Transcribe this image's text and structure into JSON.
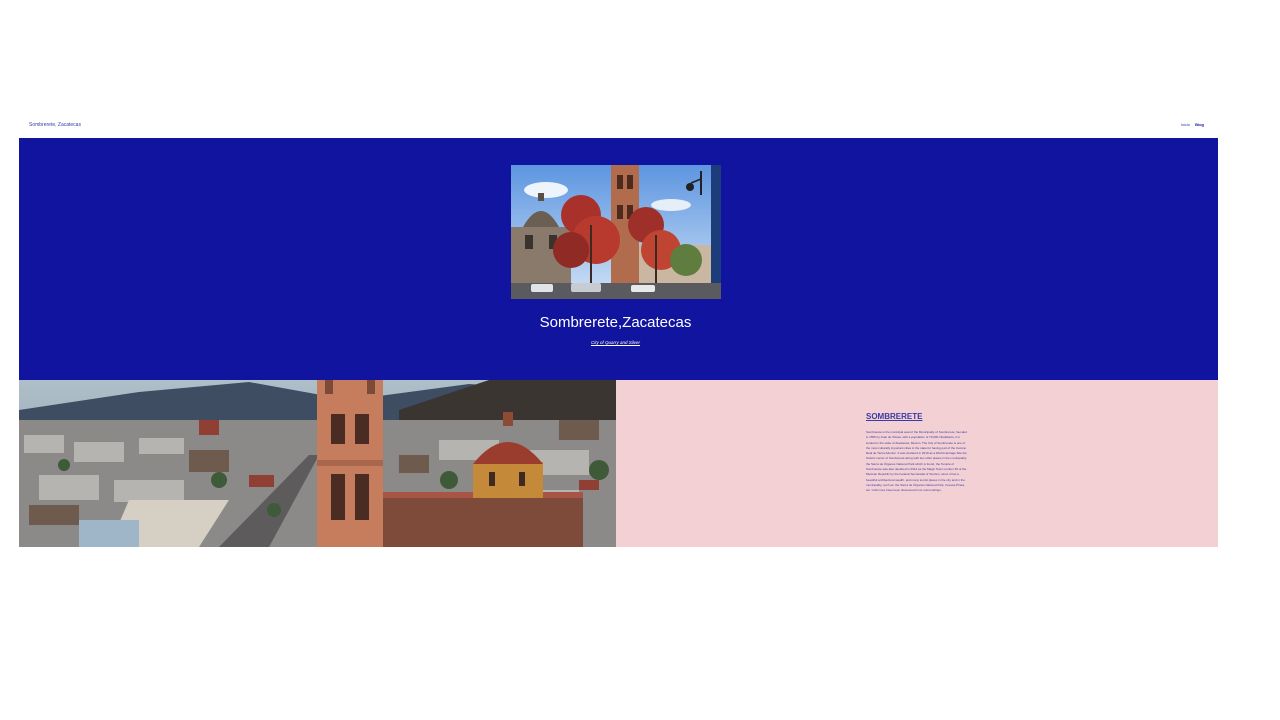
{
  "nav": {
    "site_title": "Sombrerete, Zacatecas",
    "links": [
      {
        "label": "Inicio",
        "active": false
      },
      {
        "label": "Blog",
        "active": true
      }
    ]
  },
  "hero": {
    "title": "Sombrerete,Zacatecas",
    "subtitle": "City of Quarry and Silver",
    "background_color": "#10149e",
    "photo": "cathedral-dome-and-bell-tower-with-red-tree"
  },
  "city_photo": "aerial-view-of-sombrerete-with-bell-towers",
  "info": {
    "heading": "SOMBRERETE",
    "body": "Sombrerete is the municipal seat of the Municipality of Sombrerete, founded in 1555 by Juan de Tolosa, with a population of 70,000 inhabitants; it is located in the state of Zacatecas, Mexico. The City of Sombrerete is one of the most culturally important cities in the state for having part of the Camino Real de Tierra Adentro. It was declared in 2010 as a World Heritage Site the historic center of Sombrerete along with two other places in the municipality: the Sierra de Órganos National Park which is found, the Temple of Sombrerete was also declared in 2012 as the Magic Town number 36 of the Mexican Republic by the Federal Secretariat of Tourism, since it has a beautiful architectural wealth, and many tourist places in the city and in the municipality, such as: the Sierra de Órganos National Park, Cuevas Prieta, etc. Until more have been discovered in its surroundings.",
    "background_color": "#f2d0d3",
    "text_color": "#3a3aa8"
  }
}
